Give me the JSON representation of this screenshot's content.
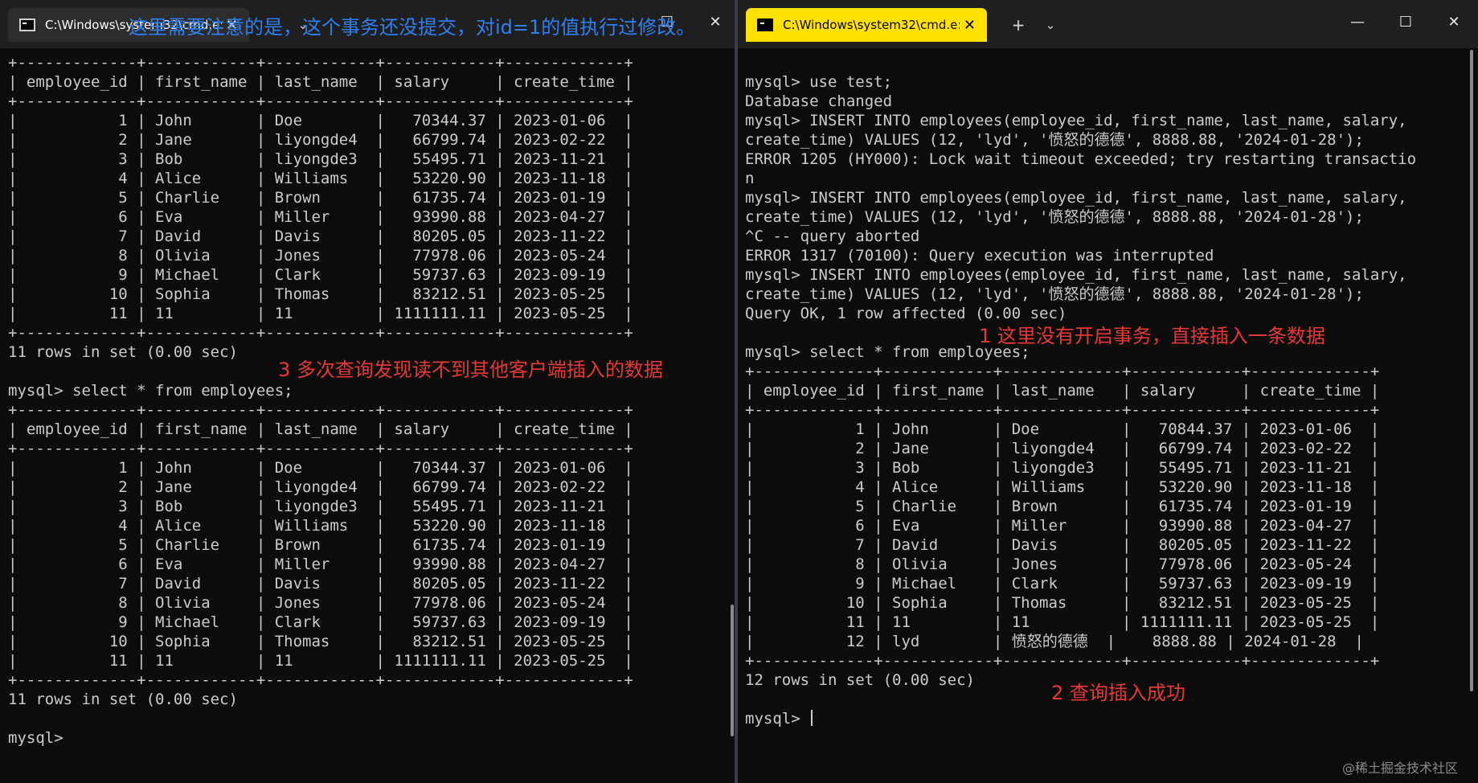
{
  "colors": {
    "console_bg": "#0c0c0c",
    "console_text": "#cccccc",
    "active_tab_bg": "#ffe100",
    "annotation_red": "#e53935",
    "annotation_blue": "#2f7ff0"
  },
  "left_window": {
    "tab_title": "C:\\Windows\\system32\\cmd.e:",
    "tab_icon": "console-icon",
    "lines": [
      "+-------------+------------+------------+------------+-------------+",
      "| employee_id | first_name | last_name  | salary     | create_time |",
      "+-------------+------------+------------+------------+-------------+",
      "|           1 | John       | Doe        |   70344.37 | 2023-01-06  |",
      "|           2 | Jane       | liyongde4  |   66799.74 | 2023-02-22  |",
      "|           3 | Bob        | liyongde3  |   55495.71 | 2023-11-21  |",
      "|           4 | Alice      | Williams   |   53220.90 | 2023-11-18  |",
      "|           5 | Charlie    | Brown      |   61735.74 | 2023-01-19  |",
      "|           6 | Eva        | Miller     |   93990.88 | 2023-04-27  |",
      "|           7 | David      | Davis      |   80205.05 | 2023-11-22  |",
      "|           8 | Olivia     | Jones      |   77978.06 | 2023-05-24  |",
      "|           9 | Michael    | Clark      |   59737.63 | 2023-09-19  |",
      "|          10 | Sophia     | Thomas     |   83212.51 | 2023-05-25  |",
      "|          11 | 11         | 11         | 1111111.11 | 2023-05-25  |",
      "+-------------+------------+------------+------------+-------------+",
      "11 rows in set (0.00 sec)",
      "",
      "mysql> select * from employees;",
      "+-------------+------------+------------+------------+-------------+",
      "| employee_id | first_name | last_name  | salary     | create_time |",
      "+-------------+------------+------------+------------+-------------+",
      "|           1 | John       | Doe        |   70344.37 | 2023-01-06  |",
      "|           2 | Jane       | liyongde4  |   66799.74 | 2023-02-22  |",
      "|           3 | Bob        | liyongde3  |   55495.71 | 2023-11-21  |",
      "|           4 | Alice      | Williams   |   53220.90 | 2023-11-18  |",
      "|           5 | Charlie    | Brown      |   61735.74 | 2023-01-19  |",
      "|           6 | Eva        | Miller     |   93990.88 | 2023-04-27  |",
      "|           7 | David      | Davis      |   80205.05 | 2023-11-22  |",
      "|           8 | Olivia     | Jones      |   77978.06 | 2023-05-24  |",
      "|           9 | Michael    | Clark      |   59737.63 | 2023-09-19  |",
      "|          10 | Sophia     | Thomas     |   83212.51 | 2023-05-25  |",
      "|          11 | 11         | 11         | 1111111.11 | 2023-05-25  |",
      "+-------------+------------+------------+------------+-------------+",
      "11 rows in set (0.00 sec)",
      "",
      "mysql>"
    ]
  },
  "right_window": {
    "tab_title": "C:\\Windows\\system32\\cmd.e:",
    "tab_icon": "console-icon",
    "new_tab_label": "+",
    "lines": [
      "",
      "mysql> use test;",
      "Database changed",
      "mysql> INSERT INTO employees(employee_id, first_name, last_name, salary,",
      "create_time) VALUES (12, 'lyd', '愤怒的德德', 8888.88, '2024-01-28');",
      "ERROR 1205 (HY000): Lock wait timeout exceeded; try restarting transactio",
      "n",
      "mysql> INSERT INTO employees(employee_id, first_name, last_name, salary,",
      "create_time) VALUES (12, 'lyd', '愤怒的德德', 8888.88, '2024-01-28');",
      "^C -- query aborted",
      "ERROR 1317 (70100): Query execution was interrupted",
      "mysql> INSERT INTO employees(employee_id, first_name, last_name, salary,",
      "create_time) VALUES (12, 'lyd', '愤怒的德德', 8888.88, '2024-01-28');",
      "Query OK, 1 row affected (0.00 sec)",
      "",
      "mysql> select * from employees;",
      "+-------------+------------+-------------+------------+-------------+",
      "| employee_id | first_name | last_name   | salary     | create_time |",
      "+-------------+------------+-------------+------------+-------------+",
      "|           1 | John       | Doe         |   70844.37 | 2023-01-06  |",
      "|           2 | Jane       | liyongde4   |   66799.74 | 2023-02-22  |",
      "|           3 | Bob        | liyongde3   |   55495.71 | 2023-11-21  |",
      "|           4 | Alice      | Williams    |   53220.90 | 2023-11-18  |",
      "|           5 | Charlie    | Brown       |   61735.74 | 2023-01-19  |",
      "|           6 | Eva        | Miller      |   93990.88 | 2023-04-27  |",
      "|           7 | David      | Davis       |   80205.05 | 2023-11-22  |",
      "|           8 | Olivia     | Jones       |   77978.06 | 2023-05-24  |",
      "|           9 | Michael    | Clark       |   59737.63 | 2023-09-19  |",
      "|          10 | Sophia     | Thomas      |   83212.51 | 2023-05-25  |",
      "|          11 | 11         | 11          | 1111111.11 | 2023-05-25  |",
      "|          12 | lyd        | 愤怒的德德  |    8888.88 | 2024-01-28  |",
      "+-------------+------------+-------------+------------+-------------+",
      "12 rows in set (0.00 sec)",
      "",
      "mysql> "
    ]
  },
  "annotations": {
    "blue_note": "这里需要注意的是，这个事务还没提交，对id=1的值执行过修改。",
    "note_1": "1 这里没有开启事务，直接插入一条数据",
    "note_2": "2 查询插入成功",
    "note_3": "3 多次查询发现读不到其他客户端插入的数据"
  },
  "watermark": "@稀土掘金技术社区"
}
